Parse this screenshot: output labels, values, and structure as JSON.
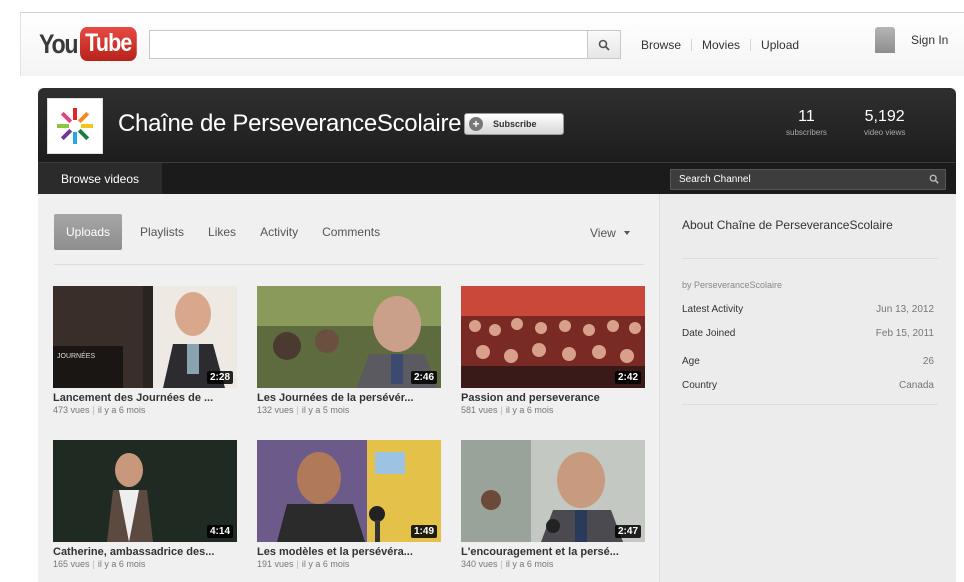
{
  "topbar": {
    "logo": {
      "you": "You",
      "tube": "Tube"
    },
    "search": {
      "value": "",
      "placeholder": "",
      "button_icon": "magnifier-icon"
    },
    "nav": [
      "Browse",
      "Movies",
      "Upload"
    ],
    "sign_in": "Sign In"
  },
  "channel": {
    "title": "Chaîne de PerseveranceScolaire",
    "subscribe_label": "Subscribe",
    "stats": [
      {
        "value": "11",
        "label": "subscribers"
      },
      {
        "value": "5,192",
        "label": "video views"
      }
    ],
    "browse_tab": "Browse videos",
    "search_placeholder": "Search Channel"
  },
  "tabs": [
    "Uploads",
    "Playlists",
    "Likes",
    "Activity",
    "Comments"
  ],
  "active_tab": "Uploads",
  "view_label": "View",
  "videos": [
    {
      "title": "Lancement des Journées de ...",
      "views": "473 vues",
      "age": "il y a 6 mois",
      "duration": "2:28"
    },
    {
      "title": "Les Journées de la persévér...",
      "views": "132 vues",
      "age": "il y a 5 mois",
      "duration": "2:46"
    },
    {
      "title": "Passion and perseverance",
      "views": "581 vues",
      "age": "il y a 6 mois",
      "duration": "2:42"
    },
    {
      "title": "Catherine, ambassadrice des...",
      "views": "165 vues",
      "age": "il y a 6 mois",
      "duration": "4:14"
    },
    {
      "title": "Les modèles et la persévéra...",
      "views": "191 vues",
      "age": "il y a 6 mois",
      "duration": "1:49"
    },
    {
      "title": "L'encouragement et la persé...",
      "views": "340 vues",
      "age": "il y a 6 mois",
      "duration": "2:47"
    }
  ],
  "about": {
    "title": "About Chaîne de PerseveranceScolaire",
    "by": "by PerseveranceScolaire",
    "rows": [
      {
        "key": "Latest Activity",
        "value": "Jun 13, 2012"
      },
      {
        "key": "Date Joined",
        "value": "Feb 15, 2011"
      },
      {
        "key": "Age",
        "value": "26"
      },
      {
        "key": "Country",
        "value": "Canada"
      }
    ]
  },
  "colors": {
    "brand_red": "#c4302b",
    "header_dark": "#262626",
    "panel": "#f0f0f0"
  }
}
